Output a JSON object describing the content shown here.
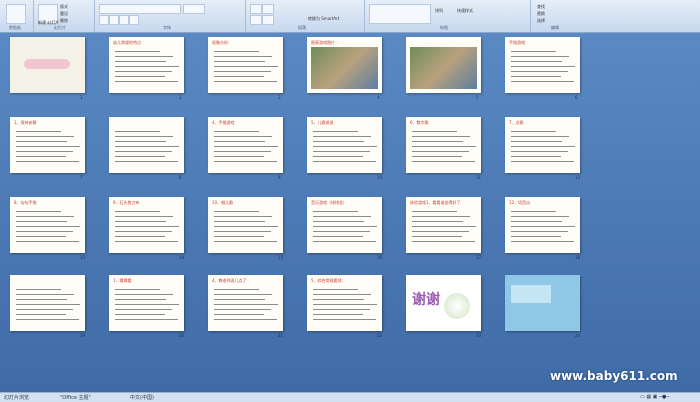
{
  "ribbon": {
    "groups": [
      {
        "label": "剪贴板"
      },
      {
        "label": "幻灯片"
      },
      {
        "label": "字体"
      },
      {
        "label": "段落"
      },
      {
        "label": "绘图"
      },
      {
        "label": "编辑"
      }
    ],
    "buttons": {
      "new_slide": "新建\n幻灯片",
      "reset": "重设",
      "delete": "删除",
      "layout": "版式",
      "convert": "转换为 SmartArt",
      "find": "查找",
      "replace": "替换",
      "select": "选择",
      "arrange": "排列",
      "quick_styles": "快速样式"
    }
  },
  "slides": [
    {
      "num": "1",
      "title": "",
      "kind": "cover"
    },
    {
      "num": "2",
      "title": "幼儿常规的特点",
      "kind": "text"
    },
    {
      "num": "3",
      "title": "现象分析：",
      "kind": "text"
    },
    {
      "num": "4",
      "title": "图表游戏图片：",
      "kind": "photo"
    },
    {
      "num": "5",
      "title": "",
      "kind": "photo"
    },
    {
      "num": "6",
      "title": "手指游戏",
      "kind": "text"
    },
    {
      "num": "7",
      "title": "1、保持安静",
      "kind": "text"
    },
    {
      "num": "8",
      "title": "",
      "kind": "text"
    },
    {
      "num": "9",
      "title": "4、手指游戏",
      "kind": "text"
    },
    {
      "num": "10",
      "title": "5、儿歌说说",
      "kind": "text"
    },
    {
      "num": "11",
      "title": "6、数字歌",
      "kind": "text"
    },
    {
      "num": "12",
      "title": "7、点歌",
      "kind": "text"
    },
    {
      "num": "13",
      "title": "8、勾勾手指",
      "kind": "text"
    },
    {
      "num": "14",
      "title": "9、石头剪刀布",
      "kind": "text"
    },
    {
      "num": "15",
      "title": "10、唱儿歌",
      "kind": "text"
    },
    {
      "num": "16",
      "title": "音乐游戏（排排坐）",
      "kind": "text"
    },
    {
      "num": "17",
      "title": "体验游戏1、看看谁坐得好了",
      "kind": "text"
    },
    {
      "num": "18",
      "title": "12、切西瓜",
      "kind": "text"
    },
    {
      "num": "19",
      "title": "",
      "kind": "text"
    },
    {
      "num": "20",
      "title": "1、猜猜看",
      "kind": "text"
    },
    {
      "num": "21",
      "title": "4、教老师说几点了",
      "kind": "text"
    },
    {
      "num": "22",
      "title": "5、综合常规要领：",
      "kind": "text"
    },
    {
      "num": "23",
      "title": "谢谢",
      "kind": "thanks"
    },
    {
      "num": "24",
      "title": "",
      "kind": "promo"
    }
  ],
  "status": {
    "view": "幻灯片浏览",
    "theme": "\"Office 主题\"",
    "language": "中文(中国)"
  },
  "watermark": "www.baby611.com"
}
